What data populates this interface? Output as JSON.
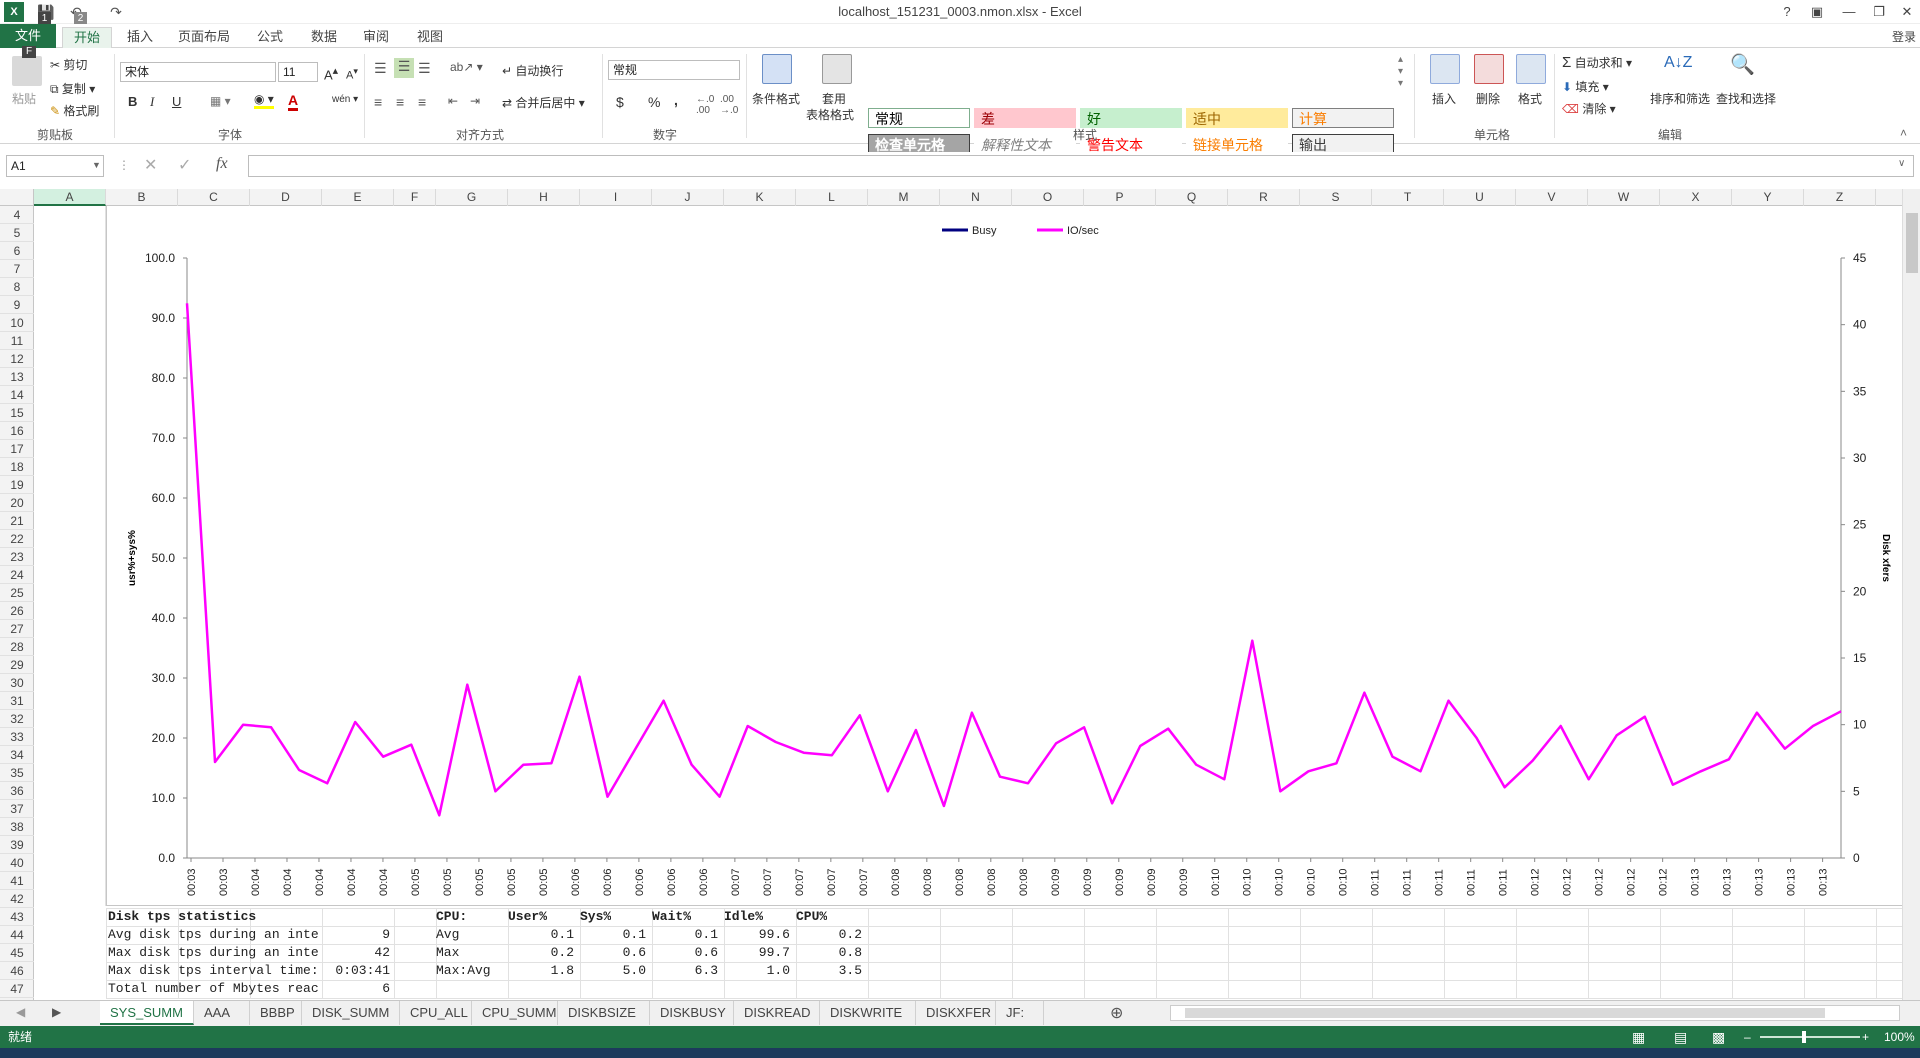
{
  "window": {
    "title": "localhost_151231_0003.nmon.xlsx - Excel",
    "login": "登录"
  },
  "qat_badges": {
    "save": "1",
    "undo": "2",
    "file": "F"
  },
  "tabs": [
    "文件",
    "开始",
    "插入",
    "页面布局",
    "公式",
    "数据",
    "审阅",
    "视图"
  ],
  "ribbon": {
    "clipboard": {
      "paste": "粘贴",
      "cut": "剪切",
      "copy": "复制",
      "format_painter": "格式刷",
      "label": "剪贴板"
    },
    "font": {
      "name": "宋体",
      "size": "11",
      "bold": "B",
      "italic": "I",
      "underline": "U",
      "label": "字体"
    },
    "align": {
      "wrap": "自动换行",
      "merge": "合并后居中",
      "label": "对齐方式"
    },
    "number": {
      "format": "常规",
      "currency": "$",
      "percent": "%",
      "comma": ",",
      "label": "数字"
    },
    "styles": {
      "cond_format": "条件格式",
      "table_format_1": "套用",
      "table_format_2": "表格格式",
      "cells": [
        {
          "text": "常规",
          "bg": "#ffffff",
          "fg": "#000000",
          "border": "#7fae8e"
        },
        {
          "text": "差",
          "bg": "#ffc7ce",
          "fg": "#9c0006",
          "border": "#ffc7ce"
        },
        {
          "text": "好",
          "bg": "#c6efce",
          "fg": "#006100",
          "border": "#c6efce"
        },
        {
          "text": "适中",
          "bg": "#ffeb9c",
          "fg": "#9c6500",
          "border": "#ffeb9c"
        },
        {
          "text": "计算",
          "bg": "#f2f2f2",
          "fg": "#fa7d00",
          "border": "#7f7f7f"
        },
        {
          "text": "检查单元格",
          "bg": "#a5a5a5",
          "fg": "#ffffff",
          "border": "#3f3f3f"
        },
        {
          "text": "解释性文本",
          "bg": "#ffffff",
          "fg": "#7f7f7f",
          "border": "#ffffff"
        },
        {
          "text": "警告文本",
          "bg": "#ffffff",
          "fg": "#ff0000",
          "border": "#ffffff"
        },
        {
          "text": "链接单元格",
          "bg": "#ffffff",
          "fg": "#fa7d00",
          "border": "#ffffff"
        },
        {
          "text": "输出",
          "bg": "#f2f2f2",
          "fg": "#3f3f3f",
          "border": "#3f3f3f"
        }
      ],
      "label": "样式"
    },
    "cells_group": {
      "insert": "插入",
      "delete": "删除",
      "format": "格式",
      "label": "单元格"
    },
    "editing": {
      "autosum": "自动求和",
      "fill": "填充",
      "clear": "清除",
      "sort": "排序和筛选",
      "find": "查找和选择",
      "label": "编辑"
    }
  },
  "formula_bar": {
    "name_box": "A1",
    "fx": "fx",
    "value": ""
  },
  "columns": [
    "A",
    "B",
    "C",
    "D",
    "E",
    "F",
    "G",
    "H",
    "I",
    "J",
    "K",
    "L",
    "M",
    "N",
    "O",
    "P",
    "Q",
    "R",
    "S",
    "T",
    "U",
    "V",
    "W",
    "X",
    "Y",
    "Z"
  ],
  "rows": [
    "4",
    "5",
    "6",
    "7",
    "8",
    "9",
    "10",
    "11",
    "12",
    "13",
    "14",
    "15",
    "16",
    "17",
    "18",
    "19",
    "20",
    "21",
    "22",
    "23",
    "24",
    "25",
    "26",
    "27",
    "28",
    "29",
    "30",
    "31",
    "32",
    "33",
    "34",
    "35",
    "36",
    "37",
    "38",
    "39",
    "40",
    "41",
    "42",
    "43",
    "44",
    "45",
    "46",
    "47"
  ],
  "table": {
    "left_rows": [
      [
        "Disk tps statistics",
        ""
      ],
      [
        "Avg disk tps during an inte",
        "9"
      ],
      [
        "Max disk tps during an inte",
        "42"
      ],
      [
        "Max disk tps interval time:",
        "0:03:41"
      ],
      [
        "Total number of Mbytes reac",
        "6"
      ]
    ],
    "cpu_header": [
      "CPU:",
      "User%",
      "Sys%",
      "Wait%",
      "Idle%",
      "CPU%"
    ],
    "cpu_rows": [
      [
        "Avg",
        "0.1",
        "0.1",
        "0.1",
        "99.6",
        "0.2"
      ],
      [
        "Max",
        "0.2",
        "0.6",
        "0.6",
        "99.7",
        "0.8"
      ],
      [
        "Max:Avg",
        "1.8",
        "5.0",
        "6.3",
        "1.0",
        "3.5"
      ]
    ]
  },
  "chart_data": {
    "type": "line",
    "title": "",
    "ylabel": "usr%+sys%",
    "y2label": "Disk xfers",
    "ylim": [
      0,
      100
    ],
    "y_ticks": [
      "0.0",
      "10.0",
      "20.0",
      "30.0",
      "40.0",
      "50.0",
      "60.0",
      "70.0",
      "80.0",
      "90.0",
      "100.0"
    ],
    "y2lim": [
      0,
      45
    ],
    "y2_ticks": [
      "0",
      "5",
      "10",
      "15",
      "20",
      "25",
      "30",
      "35",
      "40",
      "45"
    ],
    "legend": [
      "Busy",
      "IO/sec"
    ],
    "legend_position": "top-center",
    "colors": {
      "Busy": "#000080",
      "IO/sec": "#ff00ff"
    },
    "x": [
      "00:03",
      "00:03",
      "00:04",
      "00:04",
      "00:04",
      "00:04",
      "00:04",
      "00:05",
      "00:05",
      "00:05",
      "00:05",
      "00:05",
      "00:06",
      "00:06",
      "00:06",
      "00:06",
      "00:06",
      "00:07",
      "00:07",
      "00:07",
      "00:07",
      "00:07",
      "00:08",
      "00:08",
      "00:08",
      "00:08",
      "00:08",
      "00:09",
      "00:09",
      "00:09",
      "00:09",
      "00:09",
      "00:10",
      "00:10",
      "00:10",
      "00:10",
      "00:10",
      "00:11",
      "00:11",
      "00:11",
      "00:11",
      "00:11",
      "00:12",
      "00:12",
      "00:12",
      "00:12",
      "00:12",
      "00:13",
      "00:13",
      "00:13",
      "00:13",
      "00:13"
    ],
    "series": [
      {
        "name": "IO/sec",
        "axis": "right",
        "values": [
          41.6,
          7.2,
          10.0,
          9.8,
          6.6,
          5.6,
          10.2,
          7.6,
          8.5,
          3.2,
          13.0,
          5.0,
          7.0,
          7.1,
          13.6,
          4.6,
          8.2,
          11.8,
          7.0,
          4.6,
          9.9,
          8.7,
          7.9,
          7.7,
          10.7,
          5.0,
          9.6,
          3.9,
          10.9,
          6.1,
          5.6,
          8.6,
          9.8,
          4.1,
          8.4,
          9.7,
          7.0,
          5.9,
          16.3,
          5.0,
          6.5,
          7.1,
          12.4,
          7.6,
          6.5,
          11.8,
          9.0,
          5.3,
          7.3,
          9.9,
          5.9,
          9.2,
          10.6,
          5.5,
          6.5,
          7.4,
          10.9,
          8.2,
          9.9,
          11.0
        ]
      },
      {
        "name": "Busy",
        "axis": "left",
        "values": []
      }
    ]
  },
  "sheet_tabs": [
    "SYS_SUMM",
    "AAA",
    "BBBP",
    "DISK_SUMM",
    "CPU_ALL",
    "CPU_SUMM",
    "DISKBSIZE",
    "DISKBUSY",
    "DISKREAD",
    "DISKWRITE",
    "DISKXFER",
    "JF: ..."
  ],
  "status": {
    "ready": "就绪",
    "zoom": "100%"
  }
}
